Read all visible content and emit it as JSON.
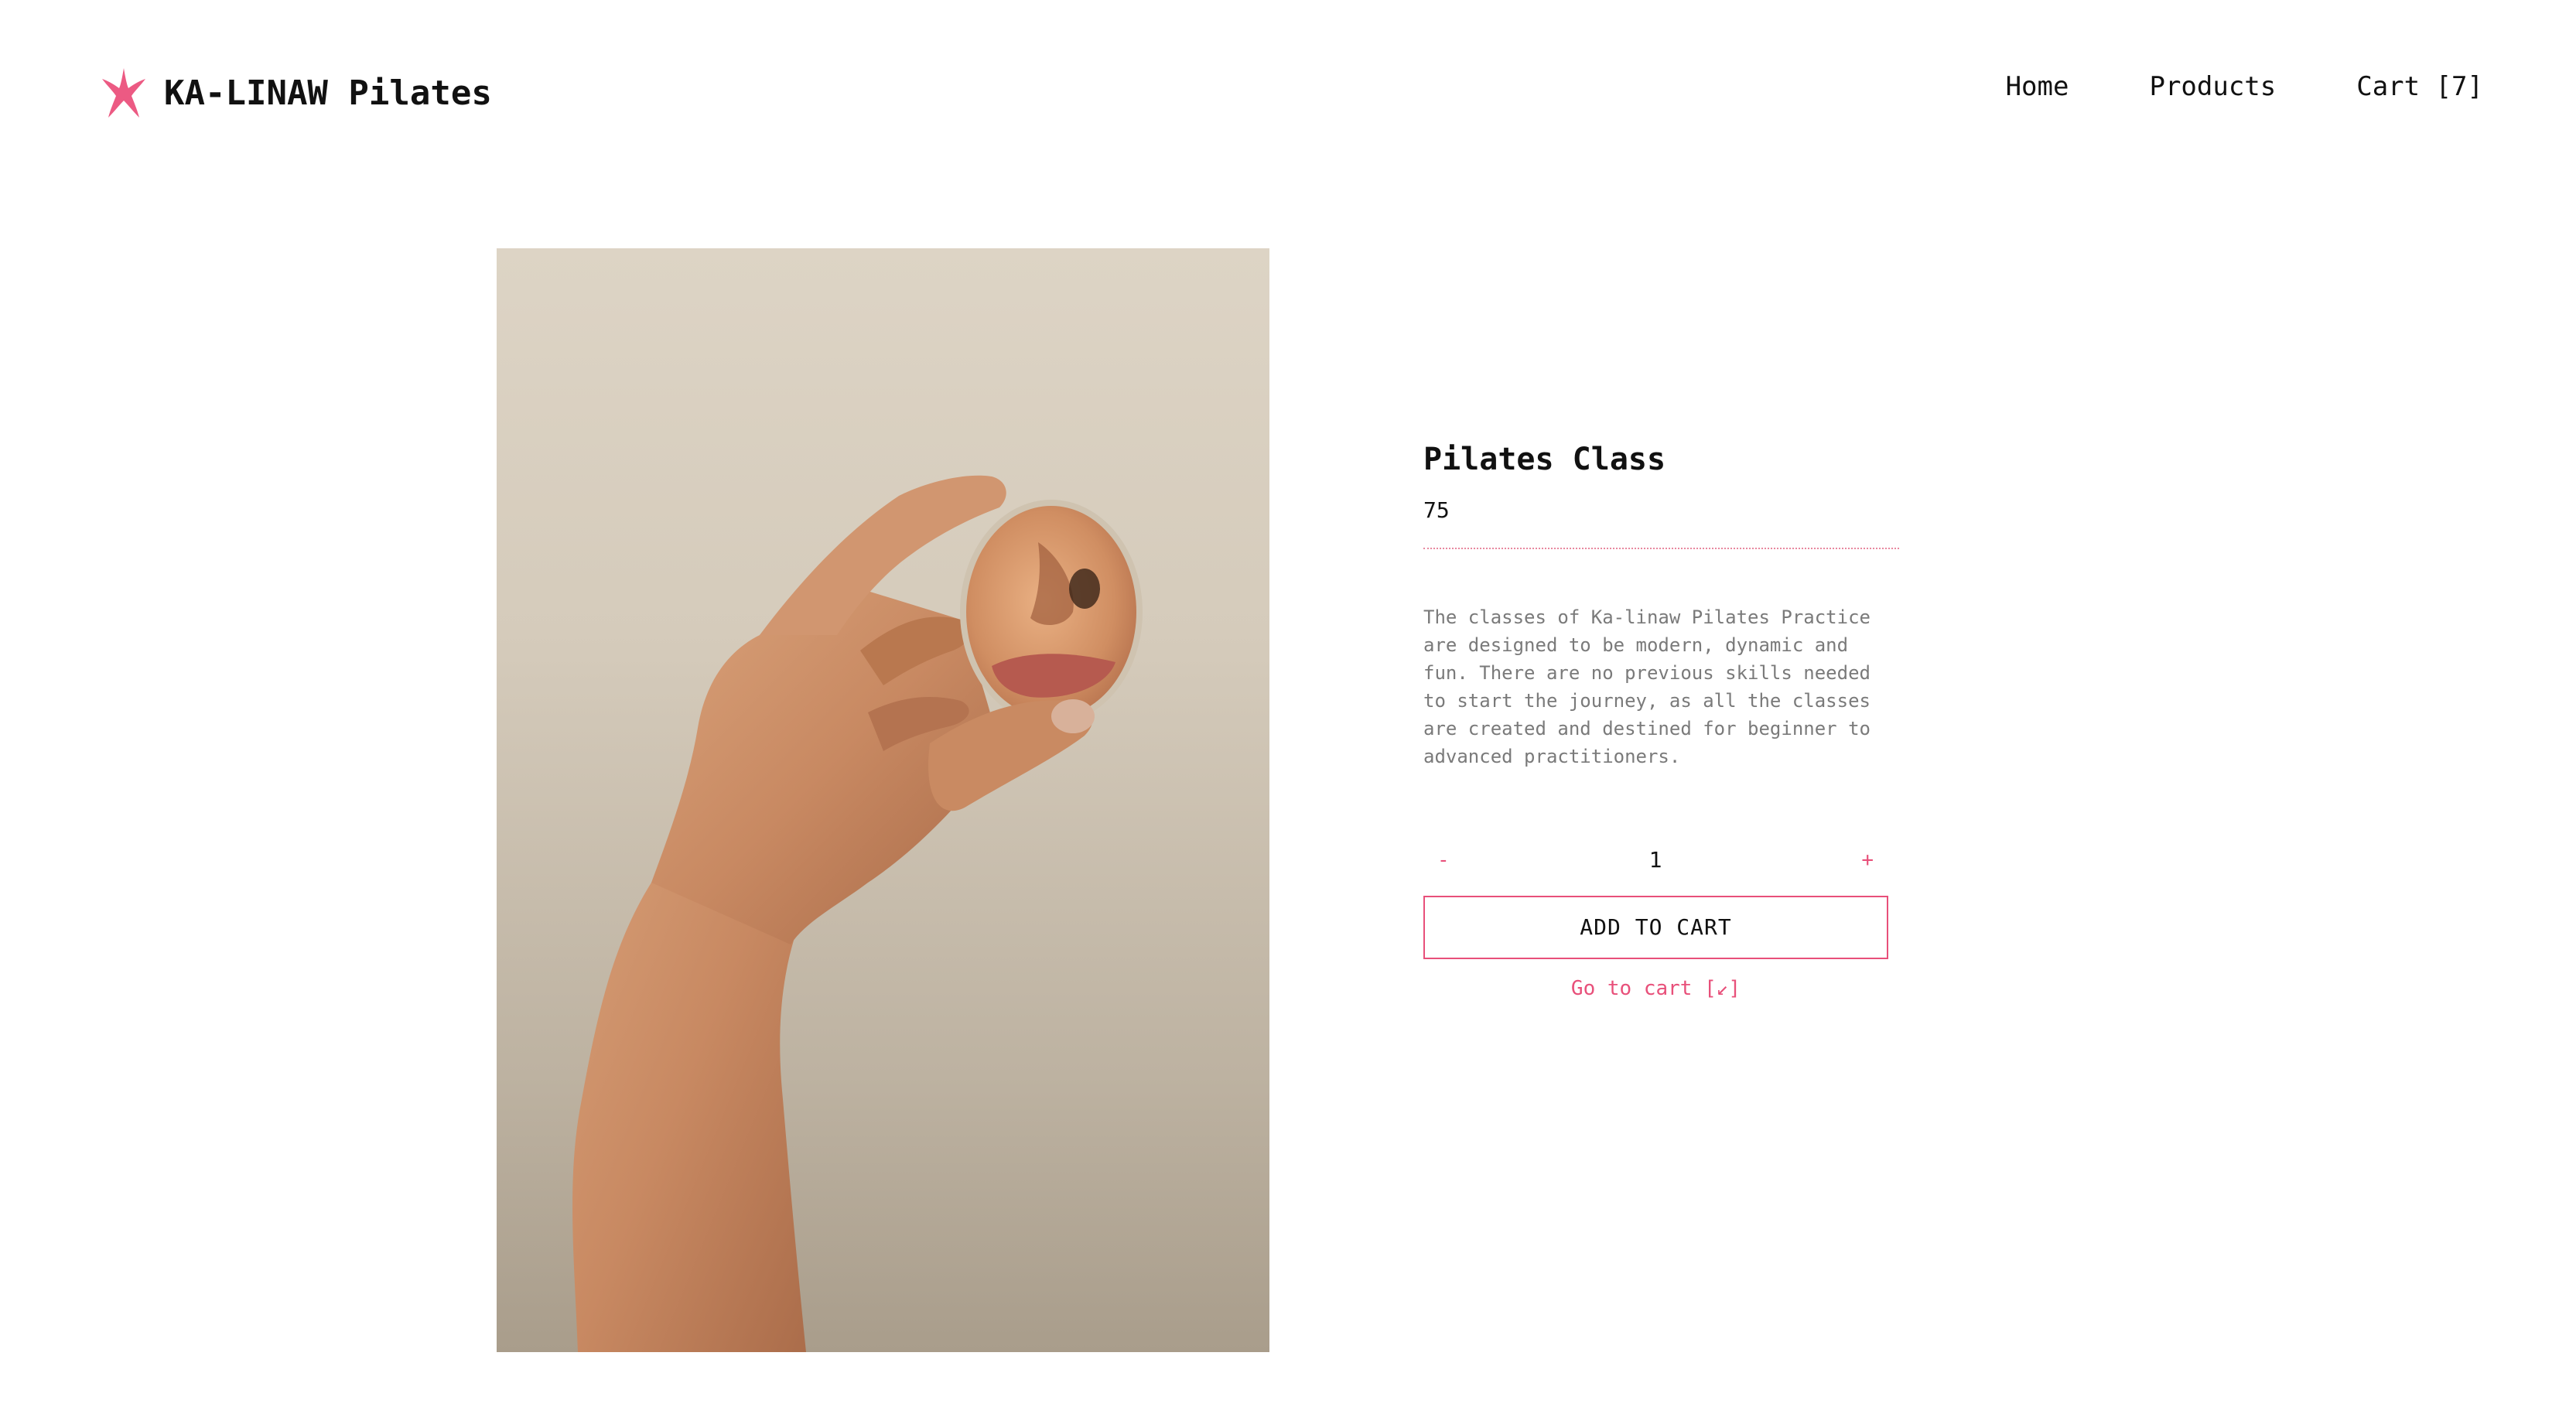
{
  "brand": {
    "name": "KA-LINAW Pilates",
    "logo_icon": "starfish-icon",
    "accent_color": "#e8507a"
  },
  "nav": {
    "items": [
      {
        "label": "Home"
      },
      {
        "label": "Products"
      },
      {
        "label": "Cart [7]"
      }
    ]
  },
  "product": {
    "image_icon": "hand-holding-mirror-image",
    "title": "Pilates Class",
    "price": "75",
    "description": "The classes of Ka-linaw Pilates Practice are designed to be modern, dynamic and fun. There are no previous skills needed to start the journey, as all the classes are created and destined for beginner to advanced practitioners.",
    "quantity": {
      "minus_label": "-",
      "value": "1",
      "plus_label": "+"
    },
    "add_to_cart_label": "ADD TO CART",
    "go_to_cart_label": "Go to cart [↙]"
  }
}
